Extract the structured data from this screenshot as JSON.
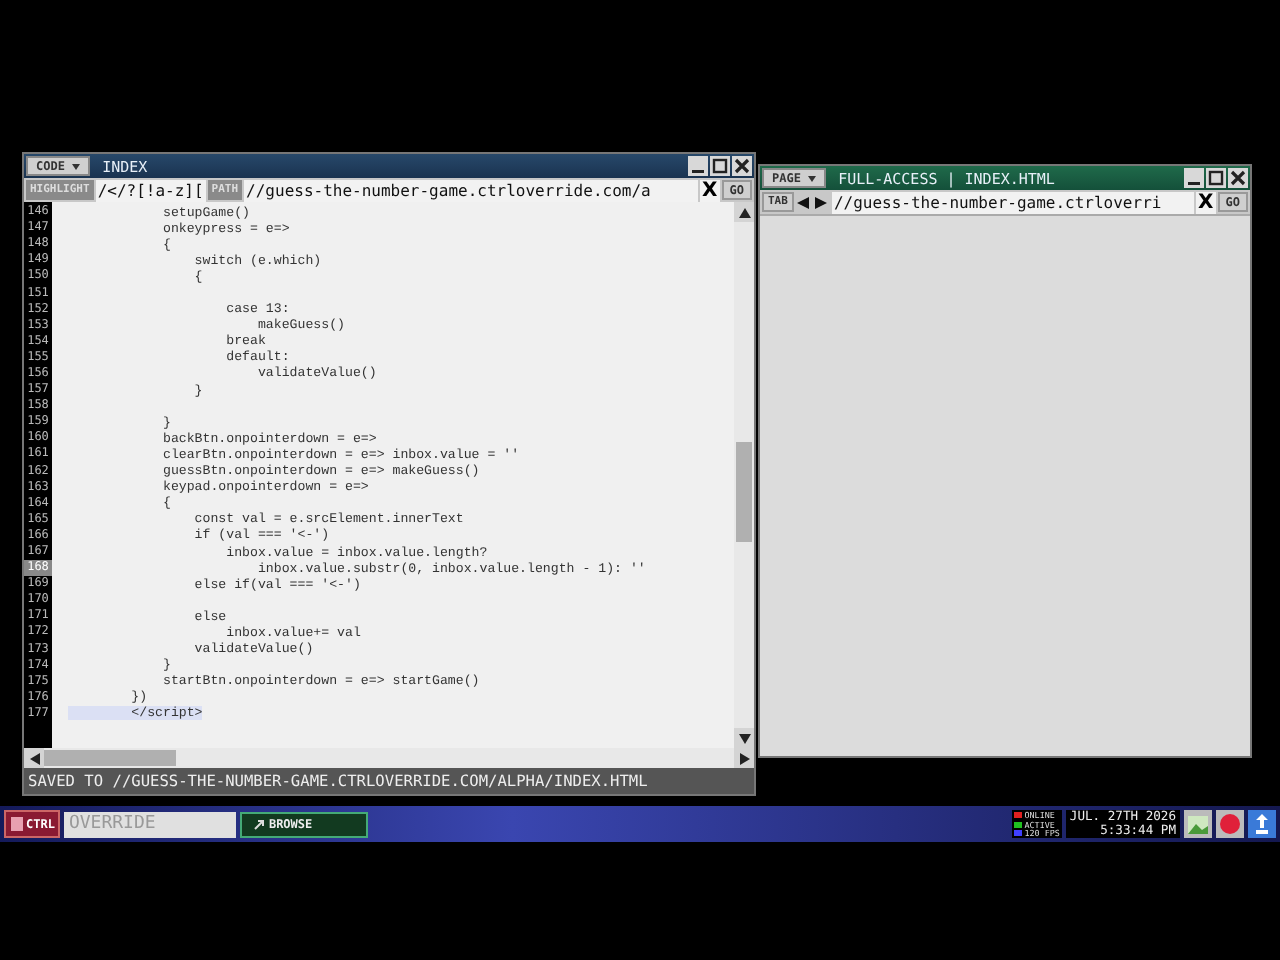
{
  "code_window": {
    "menu": "CODE",
    "title": "INDEX",
    "highlight_button": "HIGHLIGHT",
    "highlight_value": "/</?[!a-z][",
    "path_button": "PATH",
    "path_value": "//guess-the-number-game.ctrloverride.com/a",
    "clear": "X",
    "go": "GO",
    "lines": [
      {
        "number": "146",
        "text": "            setupGame()",
        "current": false
      },
      {
        "number": "147",
        "text": "            onkeypress = e=>",
        "current": false
      },
      {
        "number": "148",
        "text": "            {",
        "current": false
      },
      {
        "number": "149",
        "text": "                switch (e.which)",
        "current": false
      },
      {
        "number": "150",
        "text": "                {",
        "current": false
      },
      {
        "number": "151",
        "current": false
      },
      {
        "number": "152",
        "text": "                    case 13:",
        "current": false
      },
      {
        "number": "153",
        "text": "                        makeGuess()",
        "current": false
      },
      {
        "number": "154",
        "text": "                    break",
        "current": false
      },
      {
        "number": "155",
        "text": "                    default:",
        "current": false
      },
      {
        "number": "156",
        "text": "                        validateValue()",
        "current": false
      },
      {
        "number": "157",
        "text": "                }",
        "current": false
      },
      {
        "number": "158",
        "current": false
      },
      {
        "number": "159",
        "text": "            }",
        "current": false
      },
      {
        "number": "160",
        "text": "            backBtn.onpointerdown = e=>",
        "current": false
      },
      {
        "number": "161",
        "text": "            clearBtn.onpointerdown = e=> inbox.value = ''",
        "current": false
      },
      {
        "number": "162",
        "text": "            guessBtn.onpointerdown = e=> makeGuess()",
        "current": false
      },
      {
        "number": "163",
        "text": "            keypad.onpointerdown = e=>",
        "current": false
      },
      {
        "number": "164",
        "text": "            {",
        "current": false
      },
      {
        "number": "165",
        "text": "                const val = e.srcElement.innerText",
        "current": false
      },
      {
        "number": "166",
        "text": "                if (val === '<-')",
        "current": false
      },
      {
        "number": "167",
        "text": "                    inbox.value = inbox.value.length?",
        "current": false
      },
      {
        "number": "168",
        "text": "                        inbox.value.substr(0, inbox.value.length - 1): ''",
        "current": true
      },
      {
        "number": "169",
        "text": "                else if(val === '<-')",
        "current": false
      },
      {
        "number": "170",
        "current": false
      },
      {
        "number": "171",
        "text": "                else",
        "current": false
      },
      {
        "number": "172",
        "text": "                    inbox.value+= val",
        "current": false
      },
      {
        "number": "173",
        "text": "                validateValue()",
        "current": false
      },
      {
        "number": "174",
        "text": "            }",
        "current": false
      },
      {
        "number": "175",
        "text": "            startBtn.onpointerdown = e=> startGame()",
        "current": false
      },
      {
        "number": "176",
        "text": "        })",
        "current": false
      },
      {
        "number": "177",
        "text": "        </script>",
        "current": false
      }
    ],
    "status": "SAVED TO //GUESS-THE-NUMBER-GAME.CTRLOVERRIDE.COM/ALPHA/INDEX.HTML"
  },
  "page_window": {
    "menu": "PAGE",
    "title": "FULL-ACCESS | INDEX.HTML",
    "tab_button": "TAB",
    "address": "//guess-the-number-game.ctrloverri",
    "clear": "X",
    "go": "GO"
  },
  "taskbar": {
    "start": "CTRL",
    "command_placeholder": "OVERRIDE",
    "tasks": [
      {
        "label": "BROWSE"
      }
    ],
    "status": [
      {
        "label": "ONLINE",
        "color": "#e02020"
      },
      {
        "label": "ACTIVE",
        "color": "#20c020"
      },
      {
        "label": "120 FPS",
        "color": "#4040ff"
      }
    ],
    "date": "JUL. 27TH 2026",
    "time": "5:33:44 PM"
  }
}
